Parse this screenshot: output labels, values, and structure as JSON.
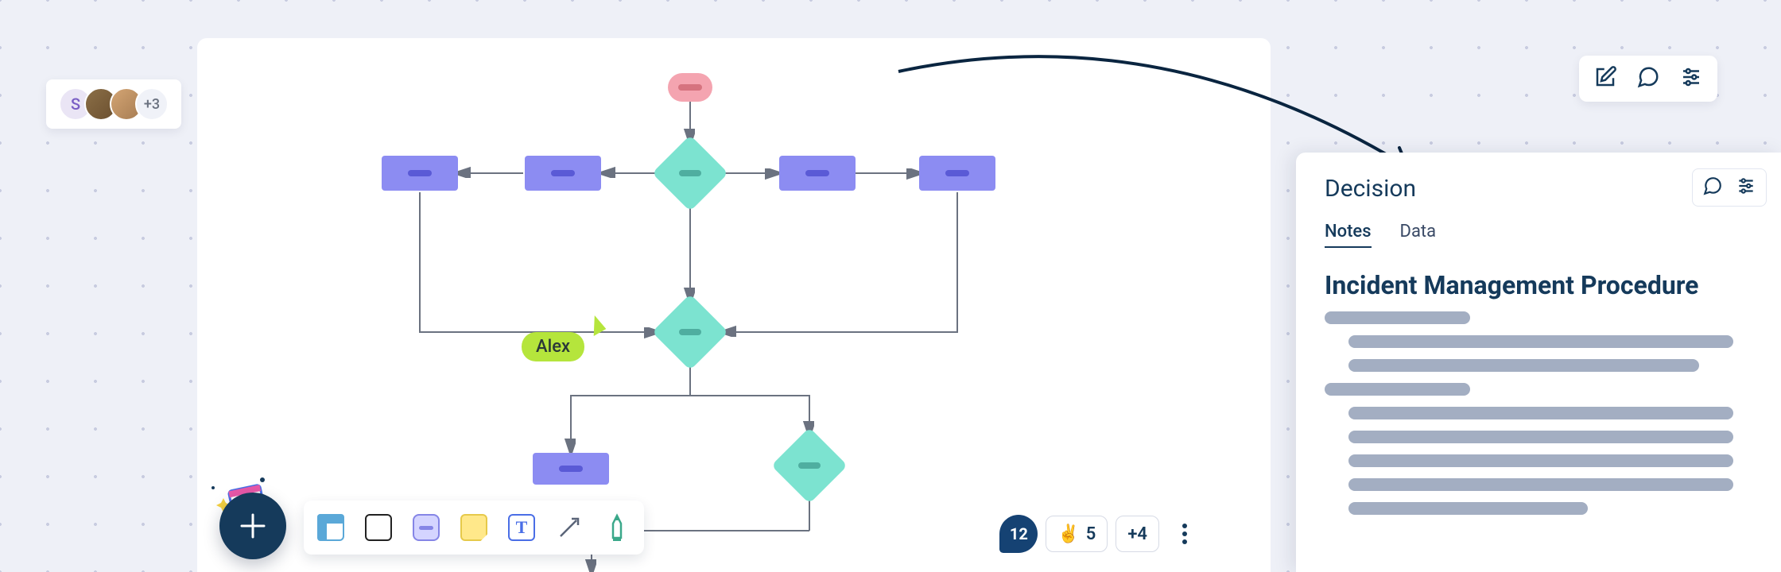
{
  "presence": {
    "initial": "S",
    "more": "+3"
  },
  "cursor": {
    "user": "Alex"
  },
  "reactions": {
    "comment_count": "12",
    "emoji_count": "5",
    "more": "+4"
  },
  "side_panel": {
    "title": "Decision",
    "tabs": {
      "notes": "Notes",
      "data": "Data"
    },
    "heading": "Incident Management Procedure"
  }
}
